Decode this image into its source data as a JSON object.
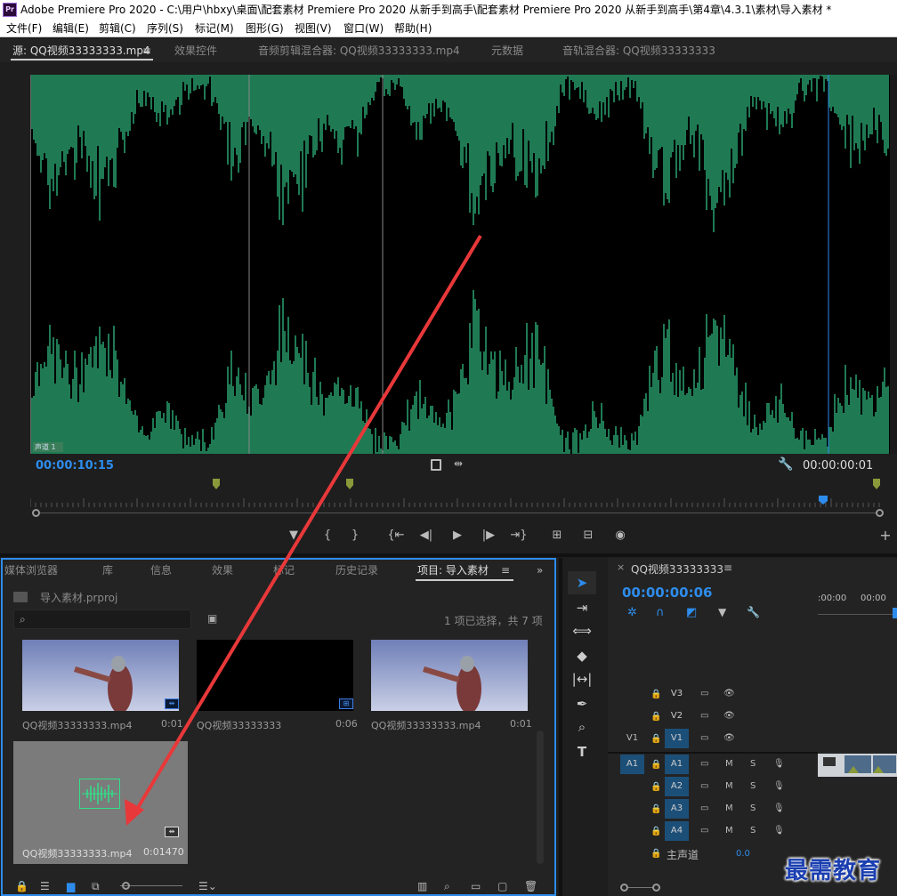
{
  "window": {
    "app_icon": "Pr",
    "title": "Adobe Premiere Pro 2020 - C:\\用户\\hbxy\\桌面\\配套素材 Premiere Pro 2020 从新手到高手\\配套素材 Premiere Pro 2020 从新手到高手\\第4章\\4.3.1\\素材\\导入素材 *"
  },
  "menu": [
    "文件(F)",
    "编辑(E)",
    "剪辑(C)",
    "序列(S)",
    "标记(M)",
    "图形(G)",
    "视图(V)",
    "窗口(W)",
    "帮助(H)"
  ],
  "source_panel": {
    "tabs": [
      "源: QQ视频33333333.mp4",
      "效果控件",
      "音频剪辑混合器: QQ视频33333333.mp4",
      "元数据",
      "音轨混合器: QQ视频33333333"
    ],
    "tab_menu_icon": "≡",
    "track_label": "声道 1",
    "current_time": "00:00:10:15",
    "duration": "00:00:00:01"
  },
  "project_panel": {
    "tabs": [
      "媒体浏览器",
      "库",
      "信息",
      "效果",
      "标记",
      "历史记录",
      "项目: 导入素材"
    ],
    "project_file": "导入素材.prproj",
    "search_placeholder": "",
    "selection_status": "1 项已选择，共 7 项",
    "clips": [
      {
        "name": "QQ视频33333333.mp4",
        "duration": "0:01",
        "kind": "video"
      },
      {
        "name": "QQ视频33333333",
        "duration": "0:06",
        "kind": "sequence"
      },
      {
        "name": "QQ视频33333333.mp4",
        "duration": "0:01",
        "kind": "video"
      },
      {
        "name": "QQ视频33333333.mp4",
        "duration": "0:01470",
        "kind": "audio"
      }
    ]
  },
  "timeline_panel": {
    "sequence_name": "QQ视频33333333",
    "current_time": "00:00:00:06",
    "ruler_labels": [
      ":00:00",
      "00:00"
    ],
    "video_tracks": [
      "V3",
      "V2",
      "V1"
    ],
    "audio_tracks": [
      "A1",
      "A2",
      "A3",
      "A4"
    ],
    "source_patch_v": "V1",
    "source_patch_a": "A1",
    "mute_label": "M",
    "solo_label": "S",
    "master_label": "主声道",
    "master_value": "0.0"
  },
  "watermark": "最需教育",
  "colors": {
    "accent_blue": "#2d8ceb",
    "waveform_green": "#1f7a54",
    "annotation_red": "#e8383a"
  }
}
